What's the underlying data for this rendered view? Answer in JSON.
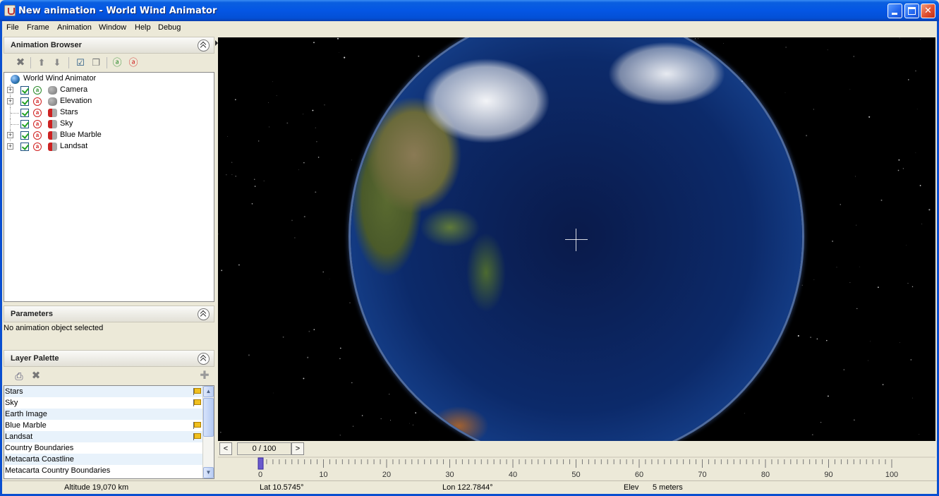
{
  "window": {
    "title": "New animation - World Wind Animator"
  },
  "menu": [
    "File",
    "Frame",
    "Animation",
    "Window",
    "Help",
    "Debug"
  ],
  "animation_browser": {
    "title": "Animation Browser",
    "root": "World Wind Animator",
    "items": [
      {
        "label": "Camera",
        "expandable": true,
        "checked": true,
        "animated": "green",
        "icon": "grey"
      },
      {
        "label": "Elevation",
        "expandable": true,
        "checked": true,
        "animated": "red",
        "icon": "grey"
      },
      {
        "label": "Stars",
        "expandable": false,
        "checked": true,
        "animated": "red",
        "icon": "redgrey"
      },
      {
        "label": "Sky",
        "expandable": false,
        "checked": true,
        "animated": "red",
        "icon": "redgrey"
      },
      {
        "label": "Blue Marble",
        "expandable": true,
        "checked": true,
        "animated": "red",
        "icon": "redgrey"
      },
      {
        "label": "Landsat",
        "expandable": true,
        "checked": true,
        "animated": "red",
        "icon": "redgrey"
      }
    ]
  },
  "parameters": {
    "title": "Parameters",
    "empty_text": "No animation object selected"
  },
  "layer_palette": {
    "title": "Layer Palette",
    "layers": [
      {
        "label": "Stars",
        "flag": true
      },
      {
        "label": "Sky",
        "flag": true
      },
      {
        "label": "Earth Image",
        "flag": false
      },
      {
        "label": "Blue Marble",
        "flag": true
      },
      {
        "label": "Landsat",
        "flag": true
      },
      {
        "label": "Country Boundaries",
        "flag": false
      },
      {
        "label": "Metacarta Coastline",
        "flag": false
      },
      {
        "label": "Metacarta Country Boundaries",
        "flag": false
      }
    ]
  },
  "timeline": {
    "frame_display": "0 / 100",
    "prev": "<",
    "next": ">",
    "current_frame": 0,
    "max_frame": 100,
    "ticks": [
      0,
      10,
      20,
      30,
      40,
      50,
      60,
      70,
      80,
      90,
      100
    ]
  },
  "status": {
    "altitude": "Altitude  19,070 km",
    "lat": "Lat 10.5745°",
    "lon": "Lon 122.7844°",
    "elev_label": "Elev",
    "elev_value": "5 meters"
  },
  "colors": {
    "titlebar": "#0456e4",
    "chrome": "#ece9d8",
    "ocean": "#0c2a6a"
  }
}
